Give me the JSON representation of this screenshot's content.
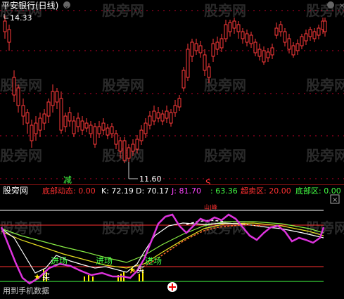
{
  "main": {
    "title": "平安银行(日线)",
    "high_label": "14.33",
    "low_label": "11.60",
    "sell_marker": "减",
    "s_marker": "S"
  },
  "indicator": {
    "name": "股旁网",
    "items": [
      {
        "label": "底部动态: 0.00",
        "color": "#ff3030"
      },
      {
        "label": "K: 72.19",
        "color": "#ffffff"
      },
      {
        "label": "D: 70.17",
        "color": "#ffffff"
      },
      {
        "label": "J: 81.70",
        "color": "#ff44ff"
      },
      {
        "label": ": 63.36",
        "color": "#44ff44"
      },
      {
        "label": "超卖区: 20.00",
        "color": "#ff3030"
      },
      {
        "label": "底部区: 0.00",
        "color": "#44ff44"
      }
    ],
    "entry_labels": [
      "进场",
      "进场",
      "进场"
    ],
    "buy_labels": [
      "买",
      "买"
    ],
    "bottom_text": "用到手机数据",
    "peaks_text": "山|峰"
  },
  "watermark": "股旁网",
  "colors": {
    "up": "#ff3a3a",
    "down": "#3ff0f0",
    "dotted": "#c0002a",
    "kd_white": "#ffffff",
    "j_magenta": "#dd33dd"
  }
}
